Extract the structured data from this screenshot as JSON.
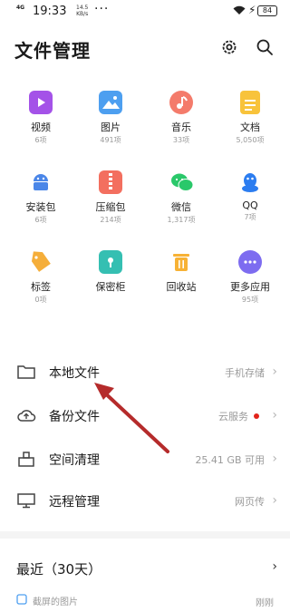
{
  "status_bar": {
    "signal": "4G",
    "time": "19:33",
    "speed_value": "14.5",
    "speed_unit": "KB/s",
    "dots": "···",
    "battery": "84"
  },
  "header": {
    "title": "文件管理"
  },
  "categories": [
    {
      "label": "视频",
      "count": "6项",
      "icon": "video-icon",
      "color": "#a452e8"
    },
    {
      "label": "图片",
      "count": "491项",
      "icon": "image-icon",
      "color": "#4d9ff0"
    },
    {
      "label": "音乐",
      "count": "33项",
      "icon": "music-icon",
      "color": "#f47b6b"
    },
    {
      "label": "文档",
      "count": "5,050项",
      "icon": "document-icon",
      "color": "#f8c33b"
    },
    {
      "label": "安装包",
      "count": "6项",
      "icon": "android-icon",
      "color": "#4a86e8"
    },
    {
      "label": "压缩包",
      "count": "214项",
      "icon": "archive-icon",
      "color": "#f36f5f"
    },
    {
      "label": "微信",
      "count": "1,317项",
      "icon": "wechat-icon",
      "color": "#2ac86a"
    },
    {
      "label": "QQ",
      "count": "7项",
      "icon": "qq-icon",
      "color": "#2c7df0"
    },
    {
      "label": "标签",
      "count": "0项",
      "icon": "tag-icon",
      "color": "#f5ae3a"
    },
    {
      "label": "保密柜",
      "count": "",
      "icon": "safe-icon",
      "color": "#35bfb2"
    },
    {
      "label": "回收站",
      "count": "",
      "icon": "trash-icon",
      "color": "#f7b235"
    },
    {
      "label": "更多应用",
      "count": "95项",
      "icon": "more-icon",
      "color": "#7d6cf0"
    }
  ],
  "list": [
    {
      "label": "本地文件",
      "value": "手机存储",
      "icon": "folder-icon"
    },
    {
      "label": "备份文件",
      "value": "云服务",
      "icon": "cloud-backup-icon"
    },
    {
      "label": "空间清理",
      "value": "25.41 GB 可用",
      "icon": "clean-icon"
    },
    {
      "label": "远程管理",
      "value": "网页传",
      "icon": "monitor-icon"
    }
  ],
  "recent": {
    "title": "最近（30天）",
    "item": "截屏的图片",
    "time": "刚刚"
  },
  "colors": {
    "accent_red": "#e2231a",
    "arrow": "#b52b2b"
  }
}
